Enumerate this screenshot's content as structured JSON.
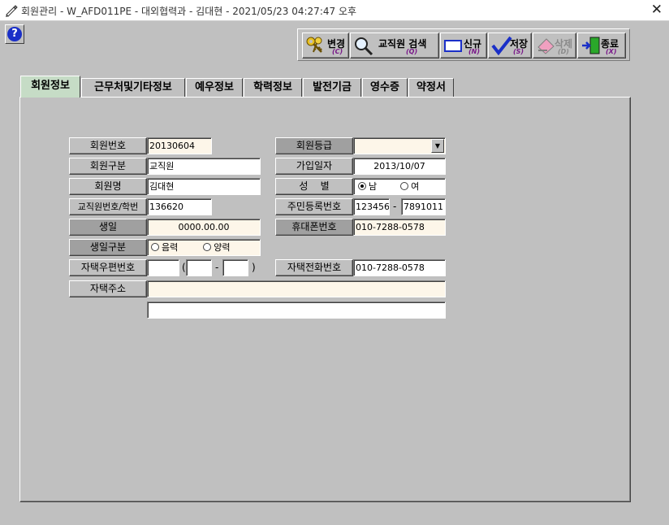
{
  "window": {
    "title": "회원관리 - W_AFD011PE - 대외협력과 - 김대현 - 2021/05/23 04:27:47 오후",
    "close_glyph": "✕",
    "help_glyph": "?"
  },
  "toolbar": {
    "buttons": [
      {
        "label": "변경",
        "hotkey": "(C)",
        "icon": "keys-icon",
        "enabled": true
      },
      {
        "label": "교직원 검색",
        "hotkey": "(Q)",
        "icon": "magnifier-icon",
        "enabled": true
      },
      {
        "label": "신규",
        "hotkey": "(N)",
        "icon": "new-document-icon",
        "enabled": true
      },
      {
        "label": "저장",
        "hotkey": "(S)",
        "icon": "checkmark-icon",
        "enabled": true
      },
      {
        "label": "삭제",
        "hotkey": "(D)",
        "icon": "eraser-icon",
        "enabled": false
      },
      {
        "label": "종료",
        "hotkey": "(X)",
        "icon": "exit-door-icon",
        "enabled": true
      }
    ]
  },
  "tabs": [
    {
      "label": "회원정보",
      "active": true
    },
    {
      "label": "근무처및기타정보",
      "active": false
    },
    {
      "label": "예우정보",
      "active": false
    },
    {
      "label": "학력정보",
      "active": false
    },
    {
      "label": "발전기금",
      "active": false
    },
    {
      "label": "영수증",
      "active": false
    },
    {
      "label": "약정서",
      "active": false
    }
  ],
  "form": {
    "member_no": {
      "label": "회원번호",
      "value": "20130604"
    },
    "member_type": {
      "label": "회원구분",
      "value": "교직원"
    },
    "member_name": {
      "label": "회원명",
      "value": "김대현"
    },
    "staff_no": {
      "label": "교직원번호/학번",
      "value": "136620"
    },
    "birthday": {
      "label": "생일",
      "value": "0000.00.00"
    },
    "birth_type": {
      "label": "생일구분",
      "options": [
        "음력",
        "양력"
      ],
      "selected": null
    },
    "home_zip": {
      "label": "자택우편번호",
      "value1": "",
      "value2": "",
      "value3": "",
      "open": "(",
      "dash": "-",
      "close": ")"
    },
    "home_address": {
      "label": "자택주소",
      "line1": "",
      "line2": ""
    },
    "member_grade": {
      "label": "회원등급",
      "value": ""
    },
    "join_date": {
      "label": "가입일자",
      "value": "2013/10/07"
    },
    "gender": {
      "label": "성    별",
      "options": [
        "남",
        "여"
      ],
      "selected": "남"
    },
    "resident_no": {
      "label": "주민등록번호",
      "part1": "123456",
      "dash": "-",
      "part2": "7891011"
    },
    "mobile": {
      "label": "휴대폰번호",
      "value": "010-7288-0578"
    },
    "home_phone": {
      "label": "자택전화번호",
      "value": "010-7288-0578"
    }
  }
}
